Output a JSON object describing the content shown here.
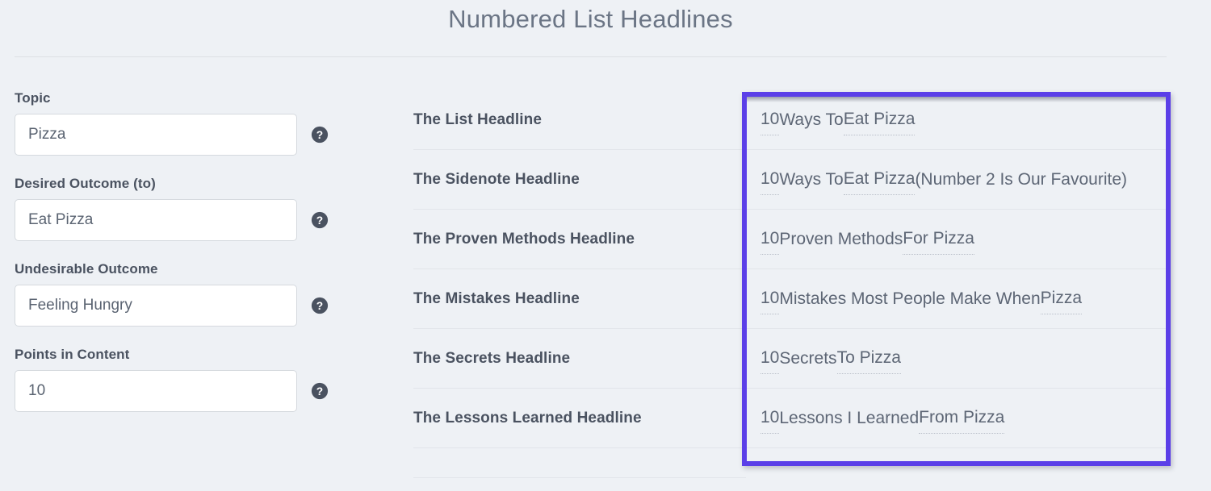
{
  "header": {
    "title": "Numbered List Headlines"
  },
  "form": {
    "fields": [
      {
        "label": "Topic",
        "value": "Pizza",
        "help_icon": "question-circle-icon"
      },
      {
        "label": "Desired Outcome (to)",
        "value": "Eat Pizza",
        "help_icon": "question-circle-icon"
      },
      {
        "label": "Undesirable Outcome",
        "value": "Feeling Hungry",
        "help_icon": "question-circle-icon"
      },
      {
        "label": "Points in Content",
        "value": "10",
        "help_icon": "question-circle-icon"
      }
    ]
  },
  "results": {
    "rows": [
      {
        "label": "The List Headline",
        "value": "10 Ways To Eat Pizza"
      },
      {
        "label": "The Sidenote Headline",
        "value": "10 Ways To Eat Pizza (Number 2 Is Our Favourite)"
      },
      {
        "label": "The Proven Methods Headline",
        "value": "10 Proven Methods For Pizza"
      },
      {
        "label": "The Mistakes Headline",
        "value": "10 Mistakes Most People Make When Pizza"
      },
      {
        "label": "The Secrets Headline",
        "value": "10 Secrets To Pizza"
      },
      {
        "label": "The Lessons Learned Headline",
        "value": "10 Lessons I Learned From Pizza"
      }
    ]
  },
  "highlight": {
    "color": "#5b3fe8",
    "target": "headline-values-column"
  },
  "colors": {
    "background": "#eef1f5",
    "text": "#4a5260",
    "muted_text": "#6b7585",
    "input_background": "#ffffff",
    "border": "#d5d9de",
    "divider": "#e2e5ea",
    "accent": "#5b3fe8"
  }
}
